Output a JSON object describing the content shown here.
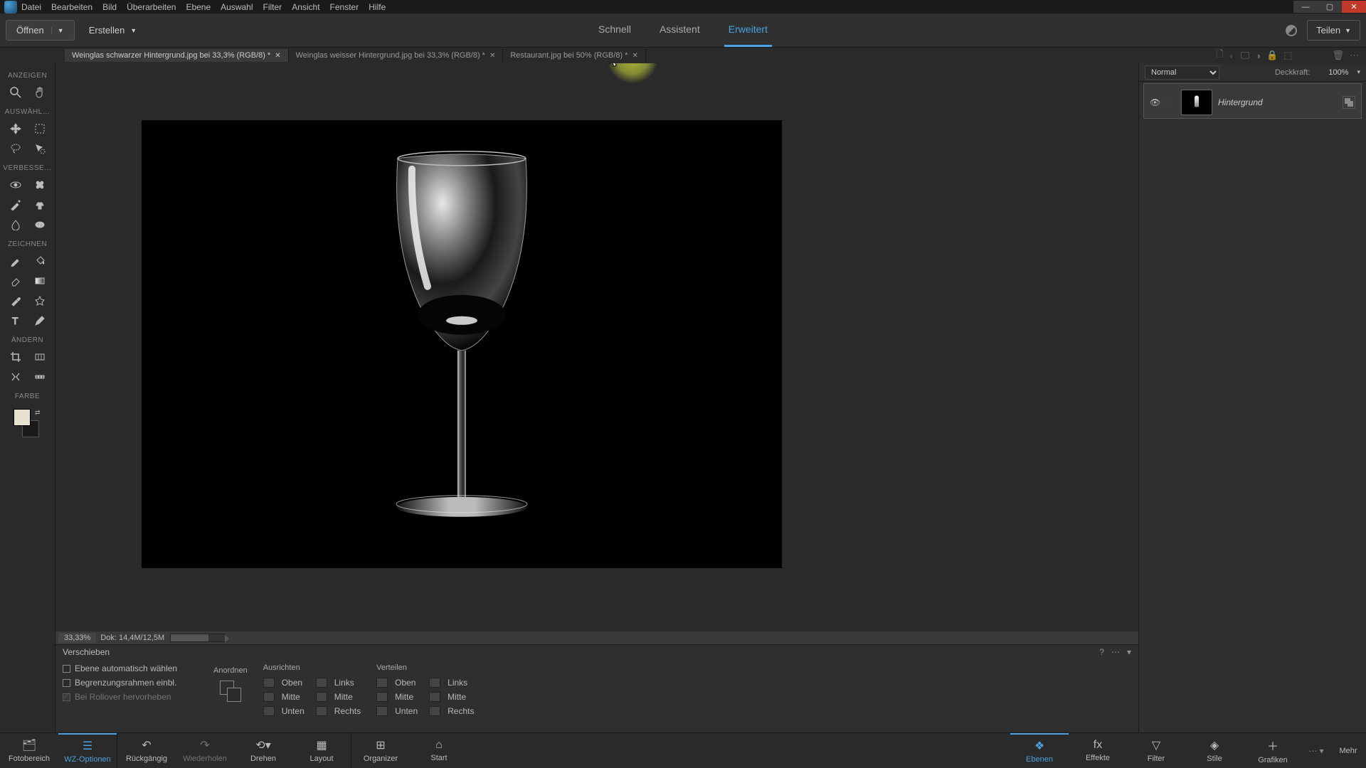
{
  "menu": [
    "Datei",
    "Bearbeiten",
    "Bild",
    "Überarbeiten",
    "Ebene",
    "Auswahl",
    "Filter",
    "Ansicht",
    "Fenster",
    "Hilfe"
  ],
  "toolbar": {
    "open": "Öffnen",
    "create": "Erstellen",
    "modes": {
      "quick": "Schnell",
      "guided": "Assistent",
      "expert": "Erweitert"
    },
    "share": "Teilen"
  },
  "tabs": [
    {
      "label": "Weinglas schwarzer Hintergrund.jpg bei 33,3% (RGB/8) *",
      "active": true
    },
    {
      "label": "Weinglas weisser Hintergrund.jpg bei 33,3% (RGB/8) *",
      "active": false
    },
    {
      "label": "Restaurant.jpg bei 50% (RGB/8) *",
      "active": false
    }
  ],
  "toolbox_sections": {
    "view": "ANZEIGEN",
    "select": "AUSWÄHL…",
    "enhance": "VERBESSE…",
    "draw": "ZEICHNEN",
    "modify": "ÄNDERN",
    "color": "FARBE"
  },
  "status": {
    "zoom": "33,33%",
    "doc": "Dok: 14,4M/12,5M"
  },
  "layers": {
    "blend_mode": "Normal",
    "opacity_label": "Deckkraft:",
    "opacity_value": "100%",
    "layer_name": "Hintergrund"
  },
  "options": {
    "title": "Verschieben",
    "auto_select": "Ebene automatisch wählen",
    "bounding": "Begrenzungsrahmen einbl.",
    "rollover": "Bei Rollover hervorheben",
    "arrange": "Anordnen",
    "align": "Ausrichten",
    "distribute": "Verteilen",
    "top": "Oben",
    "middle": "Mitte",
    "bottom": "Unten",
    "left": "Links",
    "center": "Mitte",
    "right": "Rechts"
  },
  "bottombar": {
    "photobin": "Fotobereich",
    "tooloptions": "WZ-Optionen",
    "undo": "Rückgängig",
    "redo": "Wiederholen",
    "rotate": "Drehen",
    "layout": "Layout",
    "organizer": "Organizer",
    "home": "Start",
    "layers": "Ebenen",
    "effects": "Effekte",
    "filter": "Filter",
    "styles": "Stile",
    "graphics": "Grafiken",
    "more": "Mehr"
  }
}
